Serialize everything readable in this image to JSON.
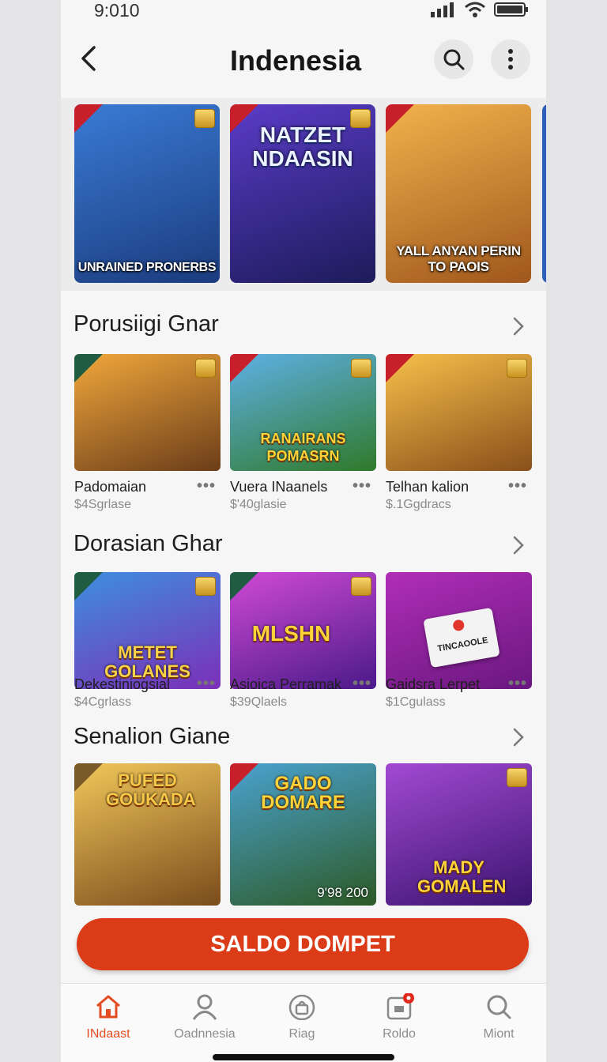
{
  "status": {
    "time": "9:010"
  },
  "header": {
    "title": "Indenesia"
  },
  "featured": [
    {
      "bottom_text": "UNRAINED PRONERBS",
      "top_text": "",
      "colors": [
        "#3a7bd5",
        "#1b3b7d"
      ]
    },
    {
      "bottom_text": "",
      "top_text": "NATZET NDAASIN",
      "colors": [
        "#5a3cc8",
        "#1d1b5a"
      ]
    },
    {
      "bottom_text": "YALL ANYAN PERIN TO PAOIS",
      "top_text": "",
      "colors": [
        "#f2b24c",
        "#a0571c"
      ]
    }
  ],
  "sections": [
    {
      "title": "Porusiigi Gnar",
      "games": [
        {
          "name": "Padomaian",
          "price": "$4Sgrlase",
          "art_text": "",
          "colors": [
            "#f1a73b",
            "#6b3d19"
          ]
        },
        {
          "name": "Vuera INaanels",
          "price": "$'40glasie",
          "art_text": "RANAIRANS POMASRN",
          "colors": [
            "#5fb0e6",
            "#2f7a2a"
          ]
        },
        {
          "name": "Telhan kalion",
          "price": "$.1Ggdracs",
          "art_text": "",
          "colors": [
            "#f7c04a",
            "#8a4f1a"
          ]
        }
      ]
    },
    {
      "title": "Dorasian Ghar",
      "games": [
        {
          "name": "Dekestiniogsial",
          "price": "$4Cgrlass",
          "art_text": "METET GOLANES",
          "colors": [
            "#3d8fe0",
            "#7b2fb8"
          ]
        },
        {
          "name": "Asioica Perramak",
          "price": "$39Qlaels",
          "art_text": "MLSHN",
          "colors": [
            "#d04ad6",
            "#4a1a8a"
          ]
        },
        {
          "name": "Gaidsra Lerpet",
          "price": "$1Cgulass",
          "art_text": "",
          "badge_text": "TINCAOOLE",
          "colors": [
            "#b02eb7",
            "#6a1780"
          ]
        }
      ]
    },
    {
      "title": "Senalion Giane",
      "games": [
        {
          "art_text": "PUFED GOUKADA",
          "colors": [
            "#f1c75a",
            "#7a4c1c"
          ]
        },
        {
          "art_text": "GADO DOMARE",
          "footer_text": "9'98 200",
          "colors": [
            "#4aa2cf",
            "#2d5a26"
          ]
        },
        {
          "art_text": "MADY GOMALEN",
          "colors": [
            "#a24ad2",
            "#3b1470"
          ]
        }
      ]
    }
  ],
  "cta": {
    "label": "SALDO DOMPET"
  },
  "nav": [
    {
      "label": "INdaast",
      "icon": "home-icon",
      "active": true
    },
    {
      "label": "Oadnnesia",
      "icon": "user-icon",
      "active": false
    },
    {
      "label": "Riag",
      "icon": "bag-icon",
      "active": false
    },
    {
      "label": "Roldo",
      "icon": "notification-icon",
      "active": false
    },
    {
      "label": "Miont",
      "icon": "search-icon",
      "active": false
    }
  ],
  "accent_color": "#dc3b18"
}
